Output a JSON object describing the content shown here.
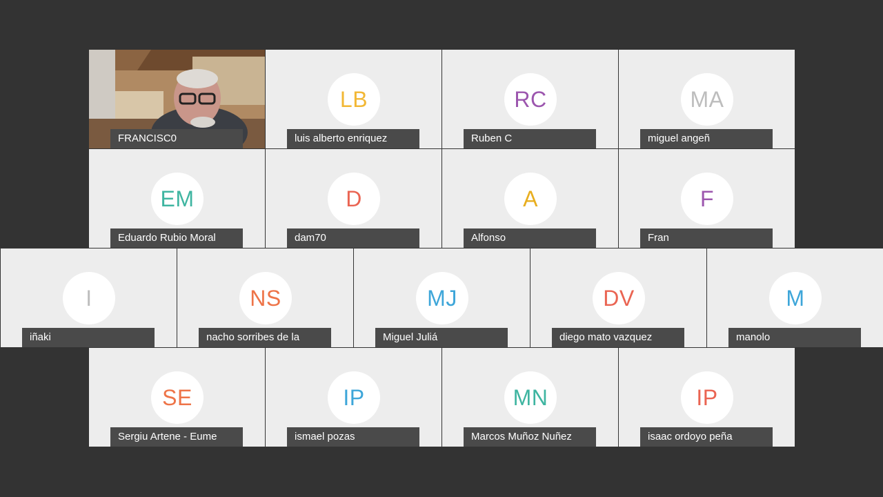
{
  "participants": [
    {
      "name": "FRANCISC0",
      "video": true
    },
    {
      "name": "luis alberto enriquez",
      "initials": "LB",
      "color": "#f2b734"
    },
    {
      "name": "Ruben C",
      "initials": "RC",
      "color": "#9c56ae"
    },
    {
      "name": "miguel angeñ",
      "initials": "MA",
      "color": "#bdbdbd"
    },
    {
      "name": "Eduardo Rubio Moral",
      "initials": "EM",
      "color": "#3fb5a1"
    },
    {
      "name": "dam70",
      "initials": "D",
      "color": "#ea6452"
    },
    {
      "name": "Alfonso",
      "initials": "A",
      "color": "#e8ae1f"
    },
    {
      "name": "Fran",
      "initials": "F",
      "color": "#9c56ae"
    },
    {
      "name": "iñaki",
      "initials": "I",
      "color": "#bdbdbd"
    },
    {
      "name": "nacho sorribes de la",
      "initials": "NS",
      "color": "#ee7448"
    },
    {
      "name": "Miguel Juliá",
      "initials": "MJ",
      "color": "#3ea6d9"
    },
    {
      "name": "diego mato vazquez",
      "initials": "DV",
      "color": "#ea6452"
    },
    {
      "name": "manolo",
      "initials": "M",
      "color": "#3ea6d9"
    },
    {
      "name": "Sergiu Artene - Eume",
      "initials": "SE",
      "color": "#ee7448"
    },
    {
      "name": "ismael pozas",
      "initials": "IP",
      "color": "#3ea6d9"
    },
    {
      "name": "Marcos Muñoz Nuñez",
      "initials": "MN",
      "color": "#3fb5a1"
    },
    {
      "name": "isaac ordoyo peña",
      "initials": "IP",
      "color": "#ea6452"
    }
  ]
}
